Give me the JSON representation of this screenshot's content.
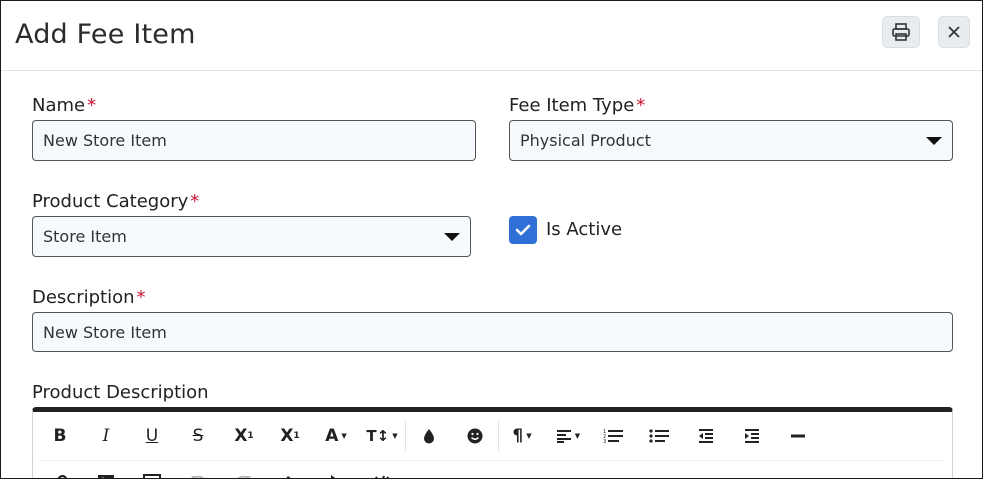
{
  "header": {
    "title": "Add Fee Item"
  },
  "form": {
    "name": {
      "label": "Name",
      "required_mark": "*",
      "value": "New Store Item"
    },
    "fee_item_type": {
      "label": "Fee Item Type",
      "required_mark": "*",
      "value": "Physical Product"
    },
    "product_category": {
      "label": "Product Category",
      "required_mark": "*",
      "value": "Store Item"
    },
    "is_active": {
      "label": "Is Active",
      "checked": true
    },
    "description": {
      "label": "Description",
      "required_mark": "*",
      "value": "New Store Item"
    },
    "product_description": {
      "label": "Product Description"
    }
  },
  "toolbar": {
    "bold": "B",
    "italic": "I",
    "underline": "U",
    "strikethrough": "S",
    "subscript_base": "X",
    "subscript_mark": "1",
    "superscript_base": "X",
    "superscript_mark": "1",
    "font_color": "A",
    "font_size": "T↕",
    "paragraph": "¶",
    "dropdown_caret": "▼"
  },
  "colors": {
    "accent": "#2f6fd6",
    "required": "#c8102e",
    "field_bg": "#f6f9fd"
  }
}
